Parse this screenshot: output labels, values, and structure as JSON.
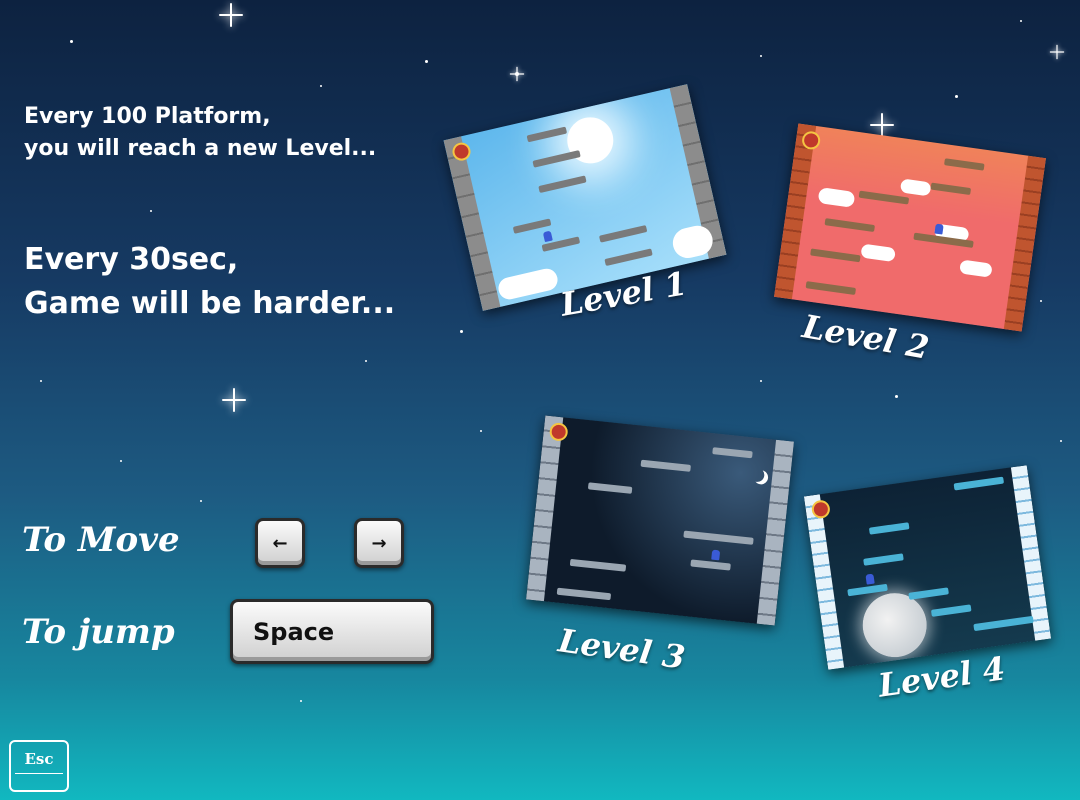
{
  "info": {
    "line1": "Every 100 Platform,",
    "line2": "you will reach a new Level...",
    "line3": "Every 30sec,",
    "line4": "Game will be harder..."
  },
  "controls": {
    "move_label": "To Move",
    "jump_label": "To jump",
    "left_key": "←",
    "right_key": "→",
    "space_key": "Space"
  },
  "esc_key": "Esc",
  "levels": [
    {
      "label": "Level 1",
      "theme": "sky",
      "background": "#6fc3f0"
    },
    {
      "label": "Level 2",
      "theme": "sunset",
      "background": "#f06b6b"
    },
    {
      "label": "Level 3",
      "theme": "night",
      "background": "#0e1b2b"
    },
    {
      "label": "Level 4",
      "theme": "ice-night",
      "background": "#0f2a3c"
    }
  ]
}
